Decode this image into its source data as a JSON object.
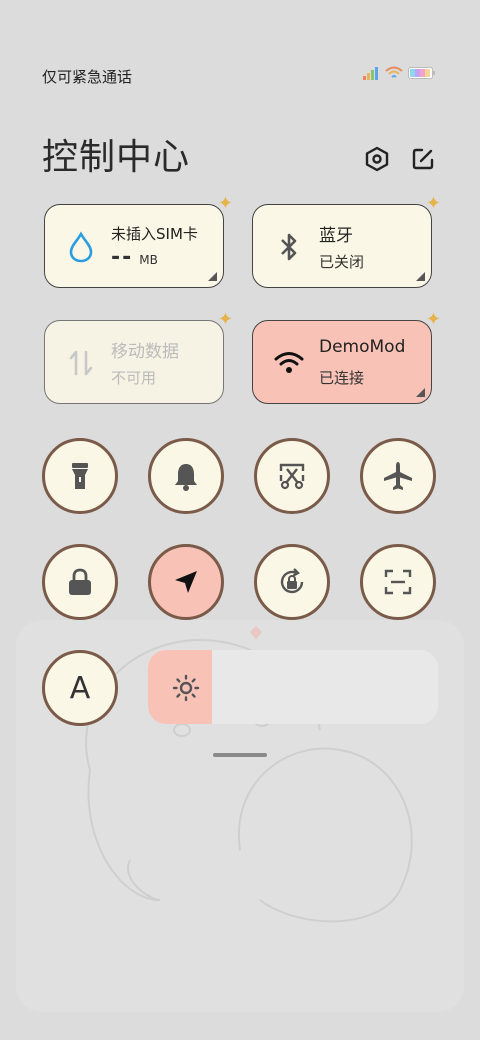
{
  "status": {
    "carrier": "仅可紧急通话"
  },
  "header": {
    "title": "控制中心",
    "settings_icon": "hexagon-gear-icon",
    "edit_icon": "edit-icon"
  },
  "tiles": [
    {
      "id": "data-usage",
      "title": "未插入SIM卡",
      "usage_value": "--",
      "usage_unit": "MB",
      "icon": "water-drop-icon",
      "state": "off"
    },
    {
      "id": "bluetooth",
      "title": "蓝牙",
      "subtitle": "已关闭",
      "icon": "bluetooth-icon",
      "state": "off"
    },
    {
      "id": "mobile-data",
      "title": "移动数据",
      "subtitle": "不可用",
      "icon": "data-arrows-icon",
      "state": "disabled"
    },
    {
      "id": "wifi",
      "title": "DemoMod",
      "subtitle": "已连接",
      "icon": "wifi-icon",
      "state": "on"
    }
  ],
  "toggles": [
    {
      "id": "flashlight",
      "icon": "flashlight-icon",
      "state": "off"
    },
    {
      "id": "ring",
      "icon": "bell-icon",
      "state": "off"
    },
    {
      "id": "screenshot",
      "icon": "scissors-screenshot-icon",
      "state": "off"
    },
    {
      "id": "airplane",
      "icon": "airplane-icon",
      "state": "off"
    },
    {
      "id": "lock",
      "icon": "lock-icon",
      "state": "off"
    },
    {
      "id": "location",
      "icon": "location-arrow-icon",
      "state": "on"
    },
    {
      "id": "rotation-lock",
      "icon": "rotation-lock-icon",
      "state": "off"
    },
    {
      "id": "scanner",
      "icon": "scan-icon",
      "state": "off"
    },
    {
      "id": "font-size",
      "icon": "letter-a-icon",
      "label": "A",
      "state": "off"
    }
  ],
  "brightness": {
    "level": 0.22,
    "icon": "sun-icon"
  },
  "colors": {
    "accent": "#f8c2b6",
    "tile_bg": "#fbf7e6",
    "ring": "#7a5a48",
    "page_bg": "#dcdcdc"
  }
}
